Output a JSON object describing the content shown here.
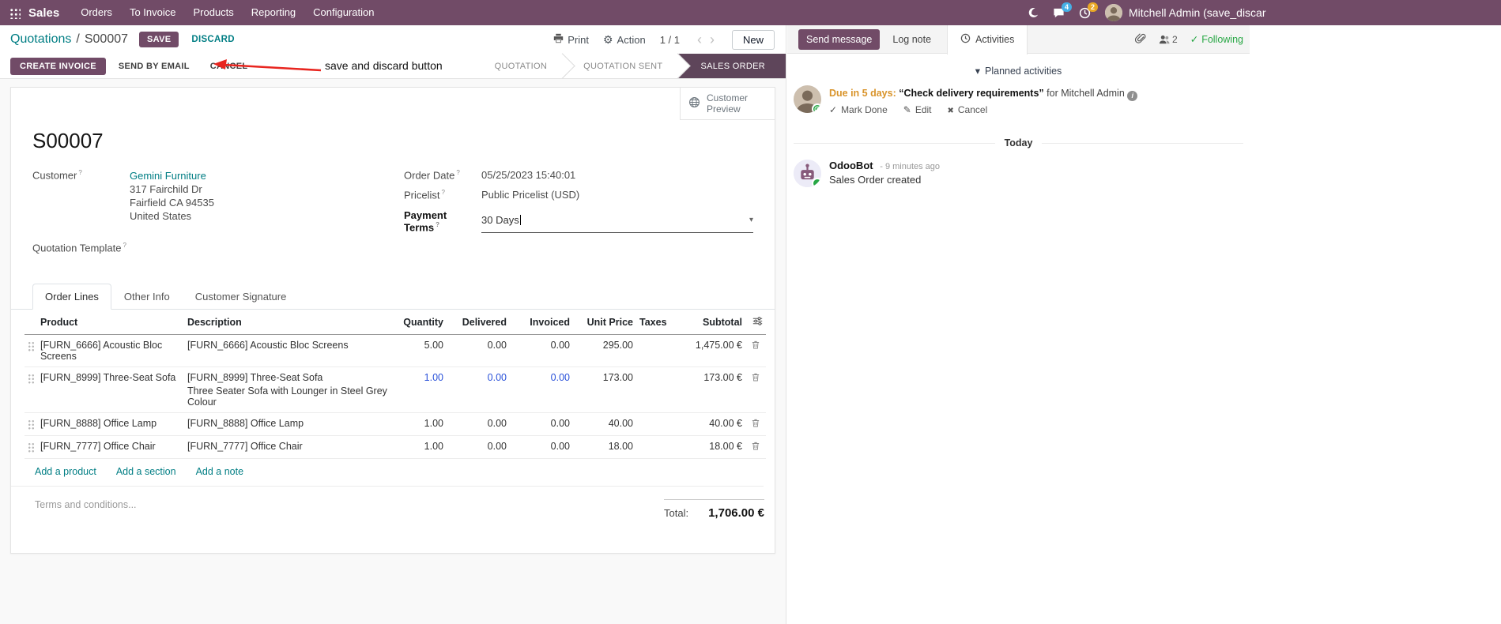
{
  "colors": {
    "accent": "#714B67",
    "link": "#017E84",
    "modified": "#2850D9",
    "state_active_bg": "#5E455A",
    "due": "#D9942B",
    "success": "#28A745",
    "badge_blue": "#45B0E6",
    "badge_orange": "#E9A825"
  },
  "topbar": {
    "app_name": "Sales",
    "menus": [
      "Orders",
      "To Invoice",
      "Products",
      "Reporting",
      "Configuration"
    ],
    "message_badge": "4",
    "activity_badge": "2",
    "user_name": "Mitchell Admin (save_discar"
  },
  "control_panel": {
    "breadcrumb_parent": "Quotations",
    "breadcrumb_sep": "/",
    "breadcrumb_current": "S00007",
    "save_label": "SAVE",
    "discard_label": "DISCARD",
    "print_label": "Print",
    "action_label": "Action",
    "pager": "1 / 1",
    "new_label": "New"
  },
  "annotation": {
    "label": "save and discard button"
  },
  "status_buttons": {
    "create_invoice": "CREATE INVOICE",
    "send_by_email": "SEND BY EMAIL",
    "cancel": "CANCEL"
  },
  "statusbar": {
    "states": [
      "QUOTATION",
      "QUOTATION SENT",
      "SALES ORDER"
    ],
    "active": "SALES ORDER"
  },
  "sheet": {
    "customer_preview_label": "Customer Preview",
    "name": "S00007",
    "customer": {
      "label": "Customer",
      "name": "Gemini Furniture",
      "street": "317 Fairchild Dr",
      "city": "Fairfield CA 94535",
      "country": "United States"
    },
    "quotation_template_label": "Quotation Template",
    "order_date": {
      "label": "Order Date",
      "value": "05/25/2023 15:40:01"
    },
    "pricelist": {
      "label": "Pricelist",
      "value": "Public Pricelist (USD)"
    },
    "payment_terms": {
      "label": "Payment Terms",
      "value": "30 Days"
    },
    "tabs": [
      {
        "label": "Order Lines"
      },
      {
        "label": "Other Info"
      },
      {
        "label": "Customer Signature"
      }
    ],
    "order_lines": {
      "headers": {
        "product": "Product",
        "description": "Description",
        "quantity": "Quantity",
        "delivered": "Delivered",
        "invoiced": "Invoiced",
        "unit_price": "Unit Price",
        "taxes": "Taxes",
        "subtotal": "Subtotal"
      },
      "rows": [
        {
          "product": "[FURN_6666] Acoustic Bloc Screens",
          "description": "[FURN_6666] Acoustic Bloc Screens",
          "quantity": "5.00",
          "delivered": "0.00",
          "invoiced": "0.00",
          "unit_price": "295.00",
          "taxes": "",
          "subtotal": "1,475.00 €"
        },
        {
          "product": "[FURN_8999] Three-Seat Sofa",
          "description": "[FURN_8999] Three-Seat Sofa",
          "description_line2": "Three Seater Sofa with Lounger in Steel Grey Colour",
          "quantity": "1.00",
          "delivered": "0.00",
          "invoiced": "0.00",
          "unit_price": "173.00",
          "taxes": "",
          "subtotal": "173.00 €"
        },
        {
          "product": "[FURN_8888] Office Lamp",
          "description": "[FURN_8888] Office Lamp",
          "quantity": "1.00",
          "delivered": "0.00",
          "invoiced": "0.00",
          "unit_price": "40.00",
          "taxes": "",
          "subtotal": "40.00 €"
        },
        {
          "product": "[FURN_7777] Office Chair",
          "description": "[FURN_7777] Office Chair",
          "quantity": "1.00",
          "delivered": "0.00",
          "invoiced": "0.00",
          "unit_price": "18.00",
          "taxes": "",
          "subtotal": "18.00 €"
        }
      ],
      "add_product": "Add a product",
      "add_section": "Add a section",
      "add_note": "Add a note"
    },
    "terms_placeholder": "Terms and conditions...",
    "total_label": "Total:",
    "total_value": "1,706.00 €"
  },
  "chatter": {
    "send_message": "Send message",
    "log_note": "Log note",
    "activities_tab": "Activities",
    "followers_count": "2",
    "following": "Following",
    "planned_activities_header": "Planned activities",
    "activity": {
      "due": "Due in 5 days:",
      "summary": "“Check delivery requirements”",
      "assignee": "for Mitchell Admin",
      "mark_done": "Mark Done",
      "edit": "Edit",
      "cancel": "Cancel"
    },
    "today_label": "Today",
    "message": {
      "author": "OdooBot",
      "timestamp": "- 9 minutes ago",
      "body": "Sales Order created"
    }
  }
}
